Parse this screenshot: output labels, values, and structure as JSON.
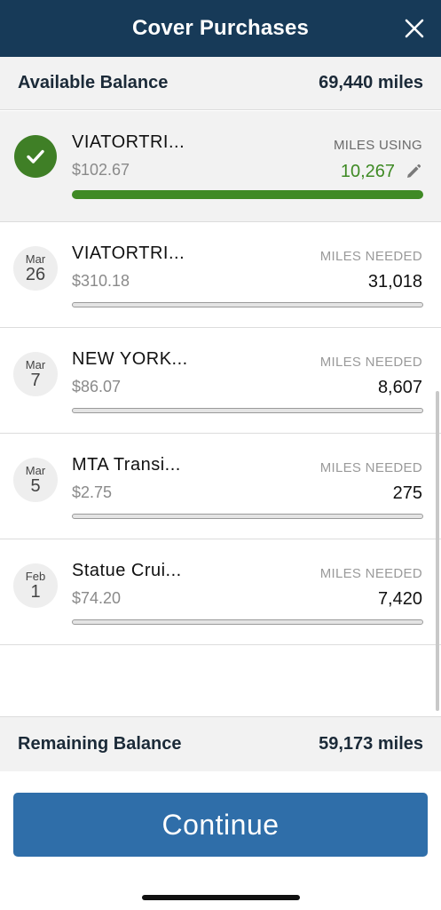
{
  "header": {
    "title": "Cover Purchases"
  },
  "available_balance": {
    "label": "Available Balance",
    "value": "69,440 miles"
  },
  "purchases": [
    {
      "selected": true,
      "merchant": "VIATORTRI...",
      "amount": "$102.67",
      "miles_label": "MILES USING",
      "miles": "10,267",
      "progress": 1.0
    },
    {
      "selected": false,
      "month": "Mar",
      "day": "26",
      "merchant": "VIATORTRI...",
      "amount": "$310.18",
      "miles_label": "MILES NEEDED",
      "miles": "31,018",
      "progress": 0
    },
    {
      "selected": false,
      "month": "Mar",
      "day": "7",
      "merchant": "NEW YORK...",
      "amount": "$86.07",
      "miles_label": "MILES NEEDED",
      "miles": "8,607",
      "progress": 0
    },
    {
      "selected": false,
      "month": "Mar",
      "day": "5",
      "merchant": "MTA Transi...",
      "amount": "$2.75",
      "miles_label": "MILES NEEDED",
      "miles": "275",
      "progress": 0
    },
    {
      "selected": false,
      "month": "Feb",
      "day": "1",
      "merchant": "Statue Crui...",
      "amount": "$74.20",
      "miles_label": "MILES NEEDED",
      "miles": "7,420",
      "progress": 0
    }
  ],
  "remaining_balance": {
    "label": "Remaining Balance",
    "value": "59,173 miles"
  },
  "continue_label": "Continue",
  "colors": {
    "header": "#173a58",
    "accent_green": "#3f8a25",
    "button_blue": "#2f6ea9"
  }
}
